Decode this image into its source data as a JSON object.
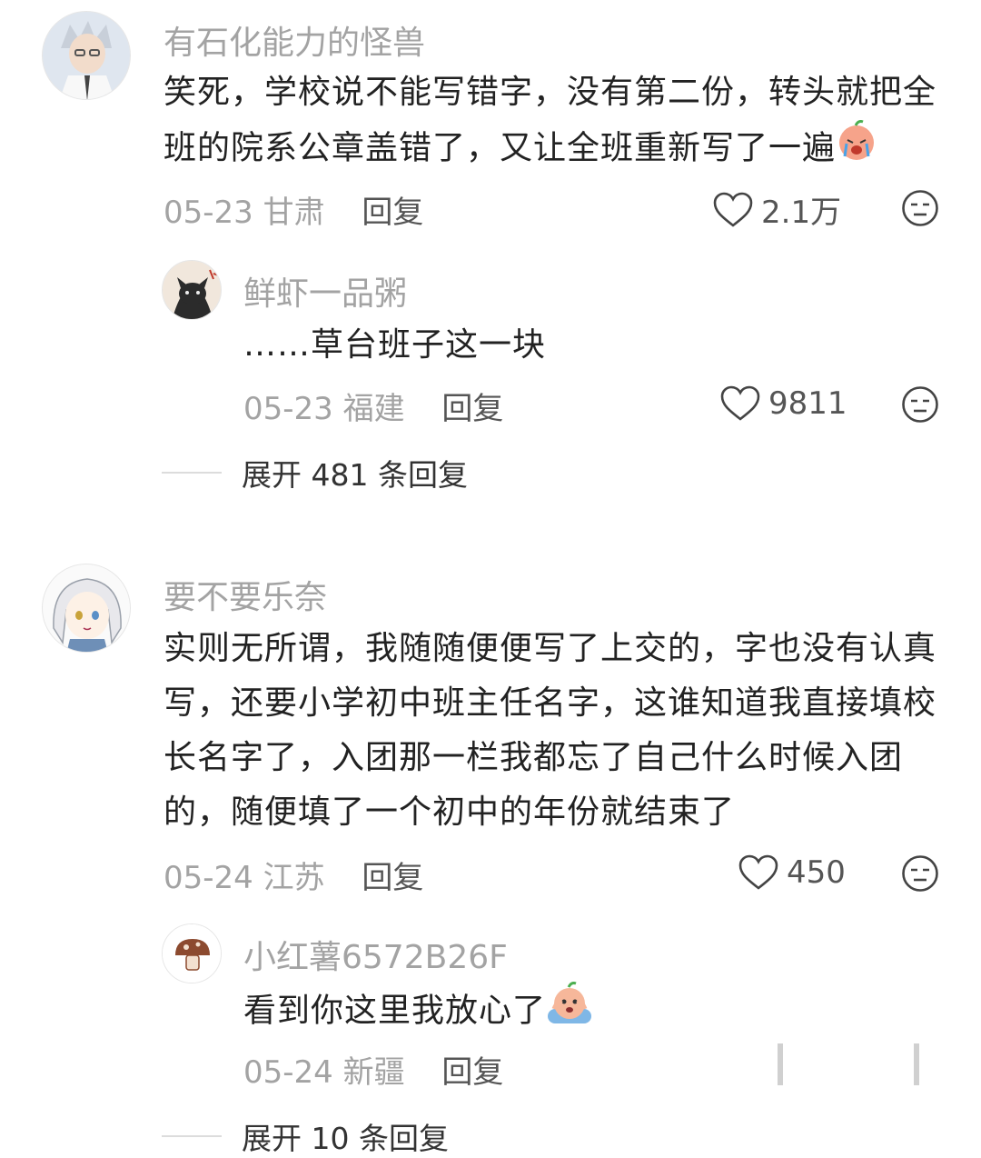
{
  "comments": [
    {
      "username": "有石化能力的怪兽",
      "text": "笑死，学校说不能写错字，没有第二份，转头就把全班的院系公章盖错了，又让全班重新写了一遍",
      "date": "05-23",
      "location": "甘肃",
      "reply_label": "回复",
      "likes": "2.1万",
      "emoji": "crying-face-emoji",
      "replies": [
        {
          "username": "鲜虾一品粥",
          "text": "……草台班子这一块",
          "date": "05-23",
          "location": "福建",
          "reply_label": "回复",
          "likes": "9811"
        }
      ],
      "expand_label": "展开 481 条回复"
    },
    {
      "username": "要不要乐奈",
      "text": "实则无所谓，我随随便便写了上交的，字也没有认真写，还要小学初中班主任名字，这谁知道我直接填校长名字了，入团那一栏我都忘了自己什么时候入团的，随便填了一个初中的年份就结束了",
      "date": "05-24",
      "location": "江苏",
      "reply_label": "回复",
      "likes": "450",
      "replies": [
        {
          "username": "小红薯6572B26F",
          "text": "看到你这里我放心了",
          "emoji": "worried-face-emoji",
          "date": "05-24",
          "location": "新疆",
          "reply_label": "回复"
        }
      ],
      "expand_label": "展开 10 条回复"
    }
  ],
  "icons": {
    "like": "heart-outline-icon",
    "dislike": "meh-face-icon"
  },
  "colors": {
    "username": "#a3a3a3",
    "text": "#222222",
    "meta": "#a3a3a3"
  }
}
